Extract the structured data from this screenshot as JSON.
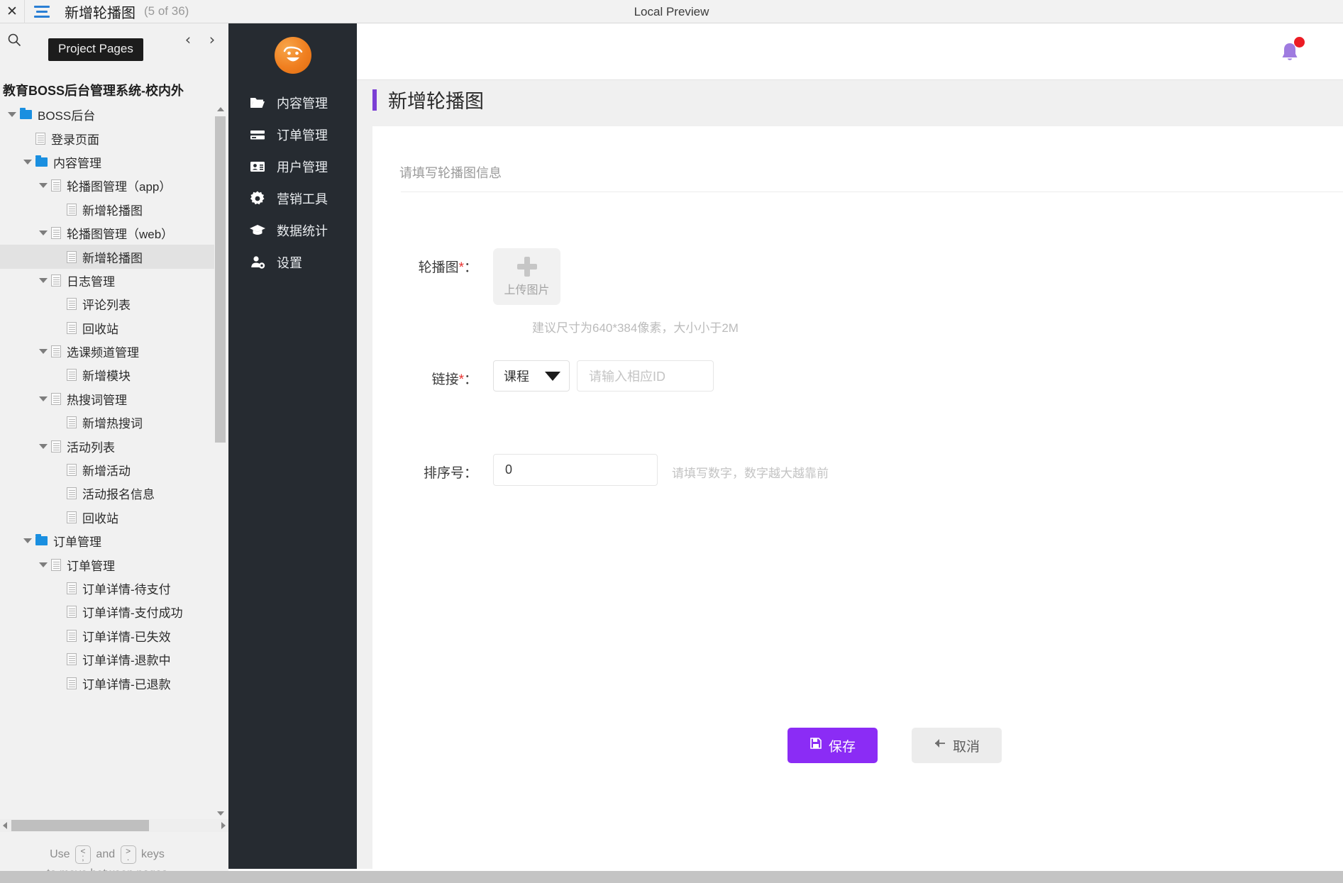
{
  "topbar": {
    "close_icon": "close-icon",
    "menu_icon": "hamburger-menu-icon",
    "page_title": "新增轮播图",
    "page_counter": "(5 of 36)",
    "center_label": "Local Preview"
  },
  "left_panel": {
    "tooltip": "Project Pages",
    "search_icon": "search-icon",
    "prev_arrow": "‹",
    "next_arrow": "›",
    "project_name": "教育BOSS后台管理系统-校内外",
    "keyboard_hint": {
      "prefix": "Use",
      "key_prev_top": "<",
      "key_prev_bottom": ";",
      "middle": "and",
      "key_next_top": ">",
      "key_next_bottom": ".",
      "suffix": "keys",
      "line2": "to move between pages"
    },
    "tree": [
      {
        "label": "BOSS后台",
        "depth": 0,
        "icon": "folder",
        "caret": true,
        "selected": false
      },
      {
        "label": "登录页面",
        "depth": 1,
        "icon": "page",
        "caret": false,
        "selected": false
      },
      {
        "label": "内容管理",
        "depth": 1,
        "icon": "folder",
        "caret": true,
        "selected": false
      },
      {
        "label": "轮播图管理（app）",
        "depth": 2,
        "icon": "page",
        "caret": true,
        "selected": false
      },
      {
        "label": "新增轮播图",
        "depth": 3,
        "icon": "page",
        "caret": false,
        "selected": false
      },
      {
        "label": "轮播图管理（web）",
        "depth": 2,
        "icon": "page",
        "caret": true,
        "selected": false
      },
      {
        "label": "新增轮播图",
        "depth": 3,
        "icon": "page",
        "caret": false,
        "selected": true
      },
      {
        "label": "日志管理",
        "depth": 2,
        "icon": "page",
        "caret": true,
        "selected": false
      },
      {
        "label": "评论列表",
        "depth": 3,
        "icon": "page",
        "caret": false,
        "selected": false
      },
      {
        "label": "回收站",
        "depth": 3,
        "icon": "page",
        "caret": false,
        "selected": false
      },
      {
        "label": "选课频道管理",
        "depth": 2,
        "icon": "page",
        "caret": true,
        "selected": false
      },
      {
        "label": "新增模块",
        "depth": 3,
        "icon": "page",
        "caret": false,
        "selected": false
      },
      {
        "label": "热搜词管理",
        "depth": 2,
        "icon": "page",
        "caret": true,
        "selected": false
      },
      {
        "label": "新增热搜词",
        "depth": 3,
        "icon": "page",
        "caret": false,
        "selected": false
      },
      {
        "label": "活动列表",
        "depth": 2,
        "icon": "page",
        "caret": true,
        "selected": false
      },
      {
        "label": "新增活动",
        "depth": 3,
        "icon": "page",
        "caret": false,
        "selected": false
      },
      {
        "label": "活动报名信息",
        "depth": 3,
        "icon": "page",
        "caret": false,
        "selected": false
      },
      {
        "label": "回收站",
        "depth": 3,
        "icon": "page",
        "caret": false,
        "selected": false
      },
      {
        "label": "订单管理",
        "depth": 1,
        "icon": "folder",
        "caret": true,
        "selected": false
      },
      {
        "label": "订单管理",
        "depth": 2,
        "icon": "page",
        "caret": true,
        "selected": false
      },
      {
        "label": "订单详情-待支付",
        "depth": 3,
        "icon": "page",
        "caret": false,
        "selected": false
      },
      {
        "label": "订单详情-支付成功",
        "depth": 3,
        "icon": "page",
        "caret": false,
        "selected": false
      },
      {
        "label": "订单详情-已失效",
        "depth": 3,
        "icon": "page",
        "caret": false,
        "selected": false
      },
      {
        "label": "订单详情-退款中",
        "depth": 3,
        "icon": "page",
        "caret": false,
        "selected": false
      },
      {
        "label": "订单详情-已退款",
        "depth": 3,
        "icon": "page",
        "caret": false,
        "selected": false
      }
    ]
  },
  "darknav": {
    "logo_icon": "smiley-face-logo",
    "items": [
      {
        "label": "内容管理",
        "icon": "folder-open-icon"
      },
      {
        "label": "订单管理",
        "icon": "credit-card-icon"
      },
      {
        "label": "用户管理",
        "icon": "id-card-icon"
      },
      {
        "label": "营销工具",
        "icon": "gear-icon"
      },
      {
        "label": "数据统计",
        "icon": "graduation-cap-icon"
      },
      {
        "label": "设置",
        "icon": "user-gear-icon"
      }
    ]
  },
  "main": {
    "bell_icon": "notification-bell-icon",
    "heading": "新增轮播图",
    "card_title": "请填写轮播图信息",
    "fields": {
      "image": {
        "label": "轮播图",
        "required_mark": "*",
        "colon": "：",
        "upload_label": "上传图片",
        "upload_icon": "plus-icon",
        "hint": "建议尺寸为640*384像素，大小小于2M"
      },
      "link": {
        "label": "链接",
        "required_mark": "*",
        "colon": "：",
        "select_value": "课程",
        "select_options": [
          "课程"
        ],
        "id_placeholder": "请输入相应ID",
        "id_value": ""
      },
      "sort": {
        "label": "排序号",
        "colon": "：",
        "value": "0",
        "hint": "请填写数字，数字越大越靠前"
      }
    },
    "buttons": {
      "save": "保存",
      "save_icon": "save-icon",
      "cancel": "取消",
      "cancel_icon": "back-icon"
    }
  },
  "colors": {
    "accent_purple": "#7b3fd4",
    "save_purple": "#8b2cf5",
    "brand_orange": "#f07f20",
    "nav_dark": "#262b31",
    "required_red": "#e8312f",
    "badge_red": "#ec1c24",
    "tree_blue": "#1a8fe0"
  }
}
